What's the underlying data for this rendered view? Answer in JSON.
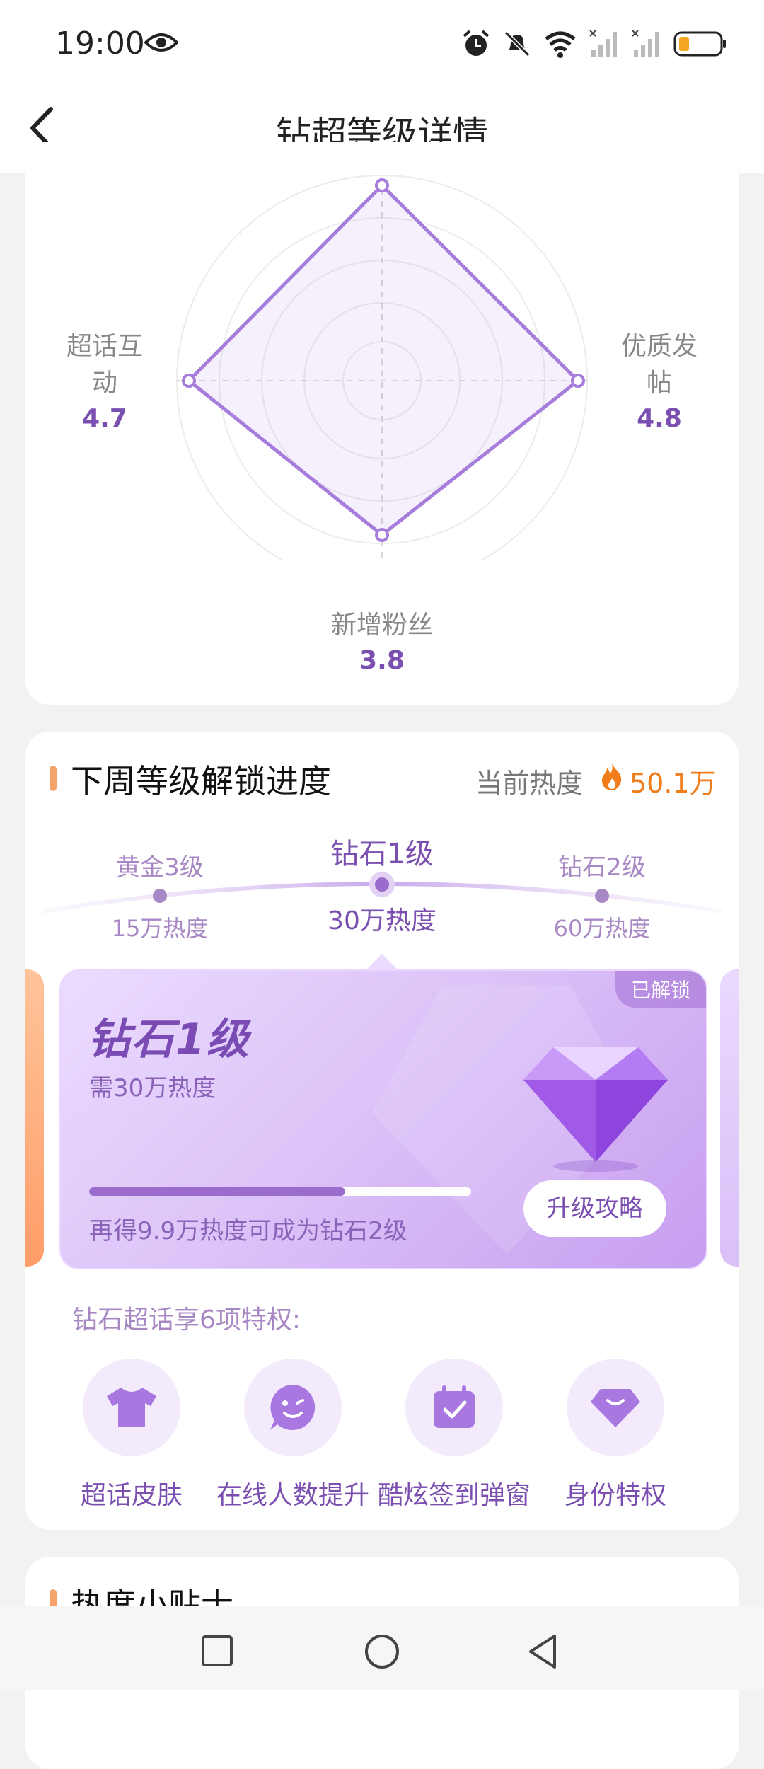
{
  "status_bar": {
    "time": "19:00"
  },
  "header": {
    "title": "钻超等级详情"
  },
  "radar": {
    "axes": [
      {
        "label_line1": "超话互",
        "label_line2": "动",
        "value": "4.7"
      },
      {
        "label_line1": "优质发",
        "label_line2": "帖",
        "value": "4.8"
      },
      {
        "label_line1": "新增粉丝",
        "label_line2": "",
        "value": "3.8"
      }
    ]
  },
  "unlock": {
    "title": "下周等级解锁进度",
    "heat_label": "当前热度",
    "heat_value": "50.1万",
    "levels": [
      {
        "name": "黄金3级",
        "heat": "15万热度"
      },
      {
        "name": "钻石1级",
        "heat": "30万热度"
      },
      {
        "name": "钻石2级",
        "heat": "60万热度"
      }
    ],
    "card": {
      "badge": "已解锁",
      "level": "钻石1级",
      "requirement": "需30万热度",
      "progress_fraction": 0.67,
      "progress_text": "再得9.9万热度可成为钻石2级",
      "button": "升级攻略"
    },
    "privileges_title": "钻石超话享6项特权:",
    "privileges": [
      {
        "label": "超话皮肤",
        "icon": "tshirt-icon"
      },
      {
        "label": "在线人数提升",
        "icon": "smiley-chat-icon"
      },
      {
        "label": "酷炫签到弹窗",
        "icon": "calendar-check-icon"
      },
      {
        "label": "身份特权",
        "icon": "diamond-badge-icon"
      }
    ]
  },
  "tips": {
    "title": "热度小贴士"
  },
  "colors": {
    "accent": "#7b4fb0",
    "heat": "#f07d1a",
    "radar_line": "#9b6fd6"
  }
}
